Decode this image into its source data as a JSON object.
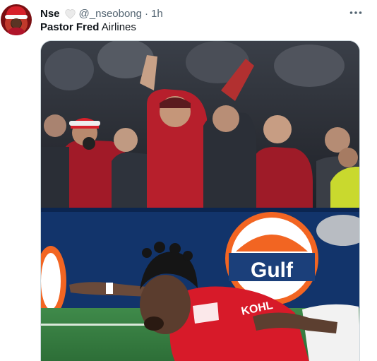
{
  "tweet": {
    "author_name": "Nse",
    "author_handle": "@_nseobong",
    "separator": "·",
    "timestamp": "1h",
    "text_bold": "Pastor Fred",
    "text_rest": " Airlines"
  },
  "icons": {
    "more": "more-horizontal-icon",
    "heart": "white-heart-icon"
  },
  "media": {
    "sponsor_board_text": "Gulf",
    "kit_text": "KOHL"
  },
  "colors": {
    "text": "#0f1419",
    "secondary": "#536471",
    "board_blue": "#12346b",
    "gulf_orange": "#f26522",
    "kit_red": "#d71a29"
  }
}
